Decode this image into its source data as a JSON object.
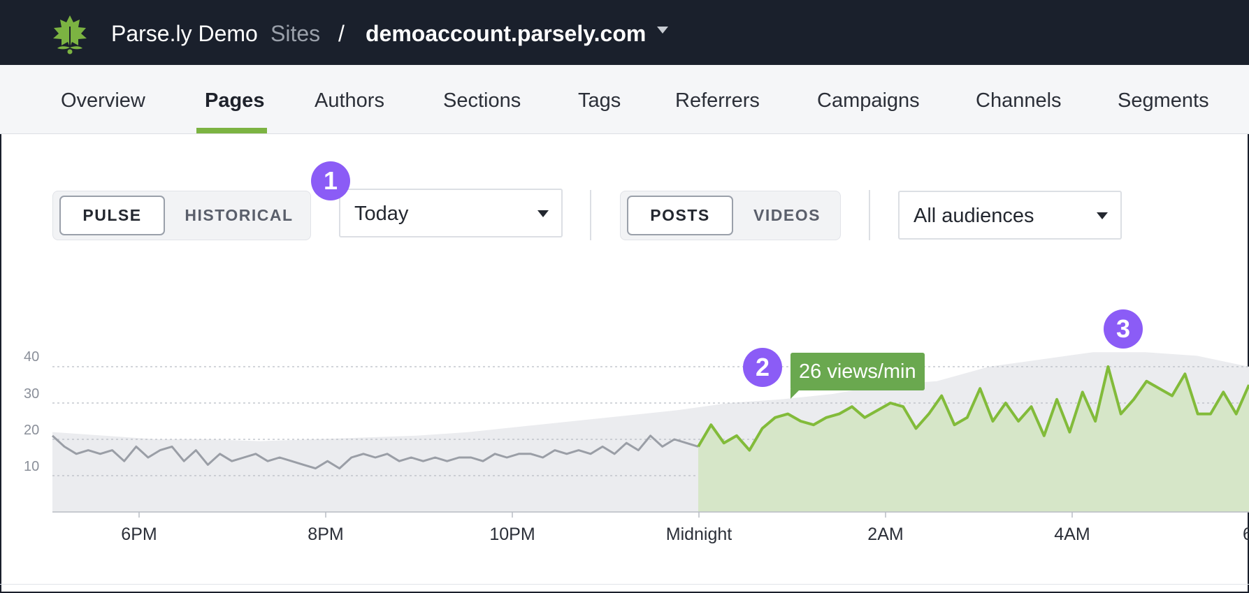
{
  "header": {
    "brand": "Parse.ly Demo",
    "sites_label": "Sites",
    "separator": "/",
    "domain": "demoaccount.parsely.com",
    "logo_icon": "parsley-leaf-icon",
    "caret_icon": "caret-down-icon"
  },
  "nav": {
    "items": [
      {
        "label": "Overview"
      },
      {
        "label": "Pages"
      },
      {
        "label": "Authors"
      },
      {
        "label": "Sections"
      },
      {
        "label": "Tags"
      },
      {
        "label": "Referrers"
      },
      {
        "label": "Campaigns"
      },
      {
        "label": "Channels"
      },
      {
        "label": "Segments"
      }
    ],
    "active": "Pages"
  },
  "controls": {
    "mode_toggle": {
      "options": [
        "PULSE",
        "HISTORICAL"
      ],
      "selected": "PULSE"
    },
    "period_select": {
      "value": "Today"
    },
    "content_toggle": {
      "options": [
        "POSTS",
        "VIDEOS"
      ],
      "selected": "POSTS"
    },
    "audience_select": {
      "value": "All audiences"
    }
  },
  "badges": [
    "1",
    "2",
    "3"
  ],
  "tooltip": {
    "text": "26 views/min"
  },
  "colors": {
    "accent_green": "#7cb342",
    "badge_purple": "#8b5cf6",
    "header_bg": "#1a202c"
  },
  "chart_data": {
    "type": "area",
    "y_ticks": [
      "10",
      "20",
      "30",
      "40"
    ],
    "x_ticks": [
      "6PM",
      "8PM",
      "10PM",
      "Midnight",
      "2AM",
      "4AM",
      "6"
    ],
    "ylim": [
      0,
      44
    ],
    "series": [
      {
        "values_before_midnight": [
          21,
          18,
          16,
          17,
          16,
          17,
          14,
          18,
          15,
          17,
          18,
          14,
          17,
          13,
          16,
          14,
          15,
          16,
          14,
          15,
          14,
          13,
          12,
          14,
          12,
          15,
          16,
          15,
          16,
          14,
          15,
          14,
          15,
          14,
          15,
          15,
          14,
          16,
          15,
          16,
          16,
          15,
          17,
          16,
          17,
          16,
          18,
          16,
          19,
          17,
          21,
          18,
          20,
          19,
          18
        ],
        "values_after_midnight": [
          18,
          24,
          19,
          21,
          17,
          23,
          26,
          27,
          25,
          24,
          26,
          27,
          29,
          26,
          28,
          30,
          29,
          23,
          27,
          32,
          24,
          26,
          34,
          25,
          30,
          25,
          29,
          21,
          31,
          22,
          33,
          25,
          40,
          27,
          31,
          36,
          34,
          32,
          38,
          27,
          27,
          33,
          27,
          35
        ]
      },
      {
        "name": "baseline",
        "values": [
          22,
          21,
          20,
          20,
          19.5,
          20,
          20.5,
          21,
          22,
          23.5,
          25,
          26.5,
          28,
          30,
          31,
          32.5,
          35,
          36,
          40,
          42,
          44,
          44,
          43,
          40
        ]
      }
    ],
    "grid": true,
    "legend": "none"
  }
}
